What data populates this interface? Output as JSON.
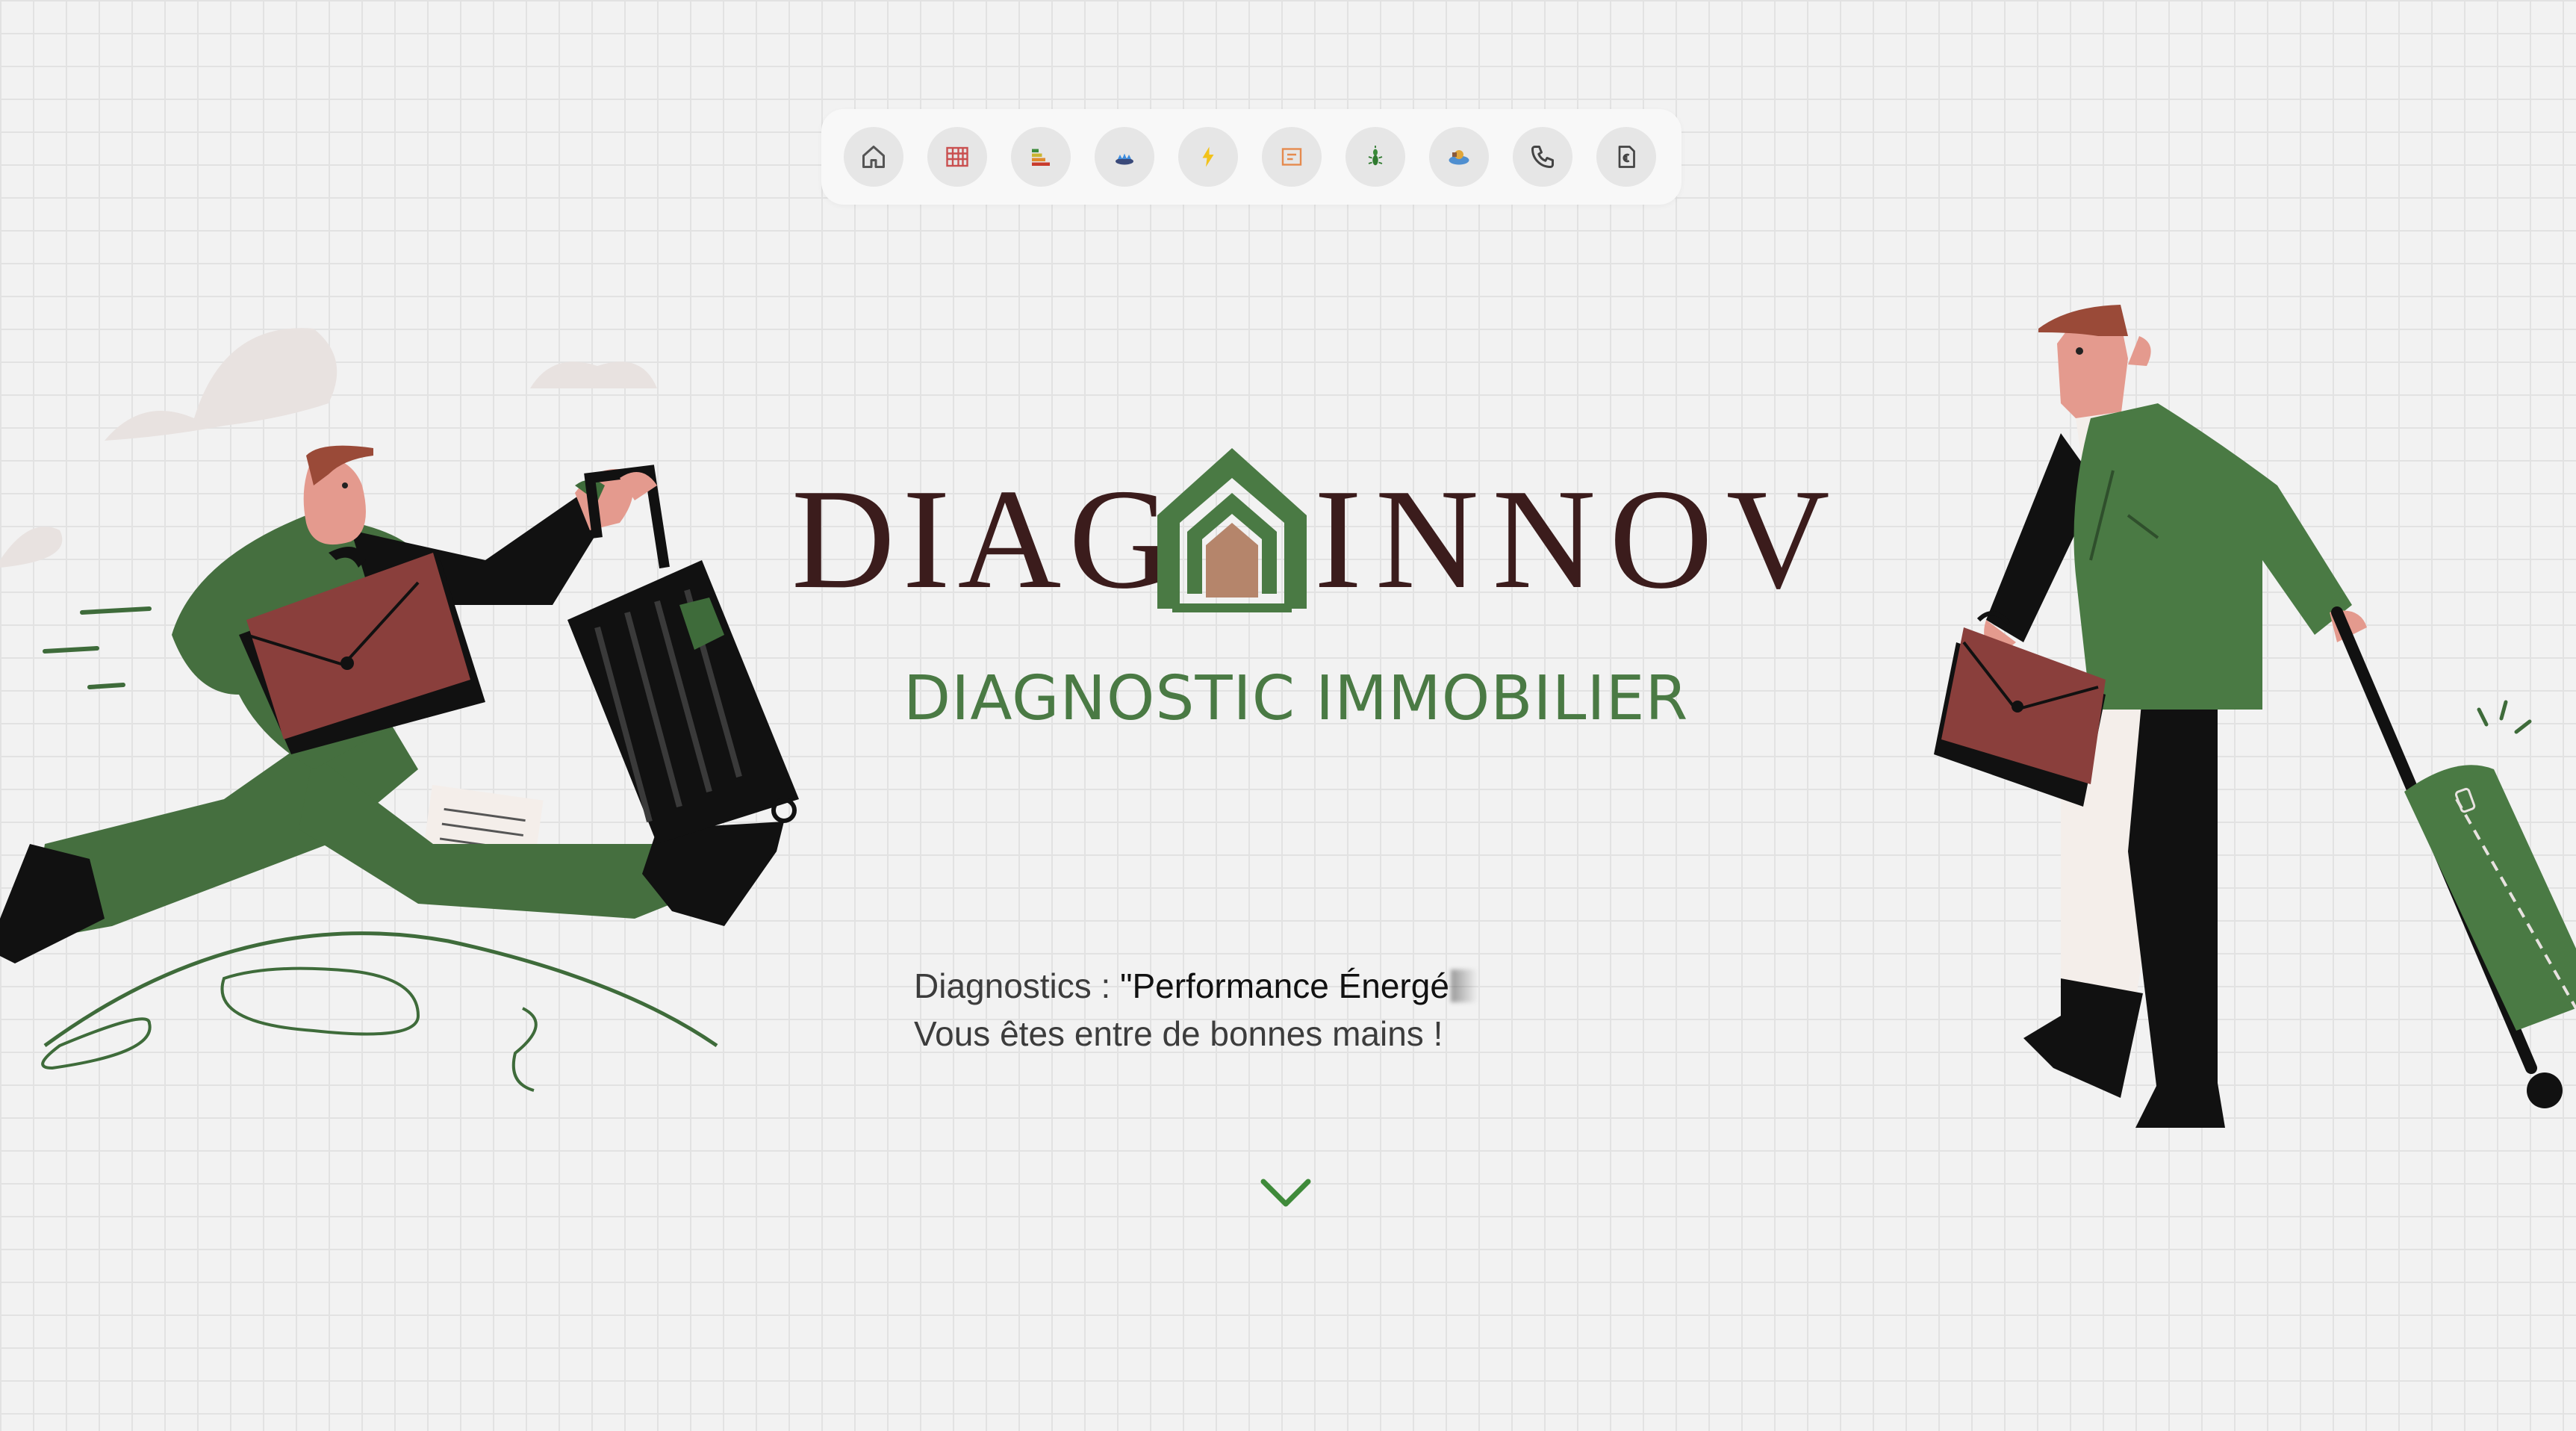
{
  "nav": {
    "items": [
      {
        "name": "accueil",
        "icon": "home-icon"
      },
      {
        "name": "amiante",
        "icon": "asbestos-grid-icon"
      },
      {
        "name": "dpe",
        "icon": "energy-rating-icon"
      },
      {
        "name": "gaz",
        "icon": "gas-flame-icon"
      },
      {
        "name": "electricite",
        "icon": "lightning-icon"
      },
      {
        "name": "surface",
        "icon": "surface-measure-icon"
      },
      {
        "name": "termites",
        "icon": "termite-icon"
      },
      {
        "name": "assainissement",
        "icon": "sanitation-icon"
      },
      {
        "name": "contact",
        "icon": "phone-icon"
      },
      {
        "name": "tarifs",
        "icon": "euro-document-icon"
      }
    ]
  },
  "brand": {
    "left": "DIAG",
    "right": "INNOV",
    "tagline": "DIAGNOSTIC IMMOBILIER"
  },
  "intro": {
    "prefix": "Diagnostics : ",
    "typed": "\"Performance Énergé",
    "subline": "Vous êtes entre de bonnes mains !"
  },
  "colors": {
    "brown": "#3b1c1c",
    "green": "#4a7a44",
    "briefcase": "#8a3f3c",
    "background": "#f2f2f2"
  }
}
